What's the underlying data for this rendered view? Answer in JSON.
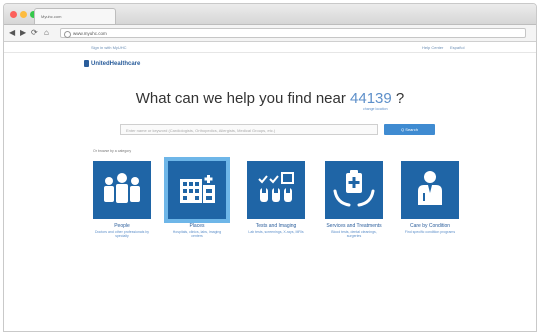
{
  "browser": {
    "tab_title": "Myuhc.com",
    "url": "www.myuhc.com",
    "back": "◀",
    "forward": "▶",
    "reload": "⟳",
    "home": "⌂"
  },
  "utility": {
    "left_link": "Sign in with MyUHC",
    "right_links": [
      "Help Center",
      "Español"
    ]
  },
  "logo": {
    "text": "UnitedHealthcare"
  },
  "hero": {
    "question": "What can we help you find near",
    "zip": "44139",
    "mark": "?",
    "change_location": "change location"
  },
  "search": {
    "placeholder": "Enter name or keyword (Cardiologists, Orthopedics, Allergists, Medical Groups, etc.)",
    "button": "Q Search"
  },
  "categories_prompt": "Or browse by a category",
  "categories": [
    {
      "label": "People",
      "desc": "Doctors and other professionals by specialty",
      "icon": "people-icon",
      "selected": false
    },
    {
      "label": "Places",
      "desc": "Hospitals, clinics, labs, imaging centers",
      "icon": "hospital-icon",
      "selected": true
    },
    {
      "label": "Tests and Imaging",
      "desc": "Lab tests, screenings, X-rays, MRIs",
      "icon": "tests-icon",
      "selected": false
    },
    {
      "label": "Services and Treatments",
      "desc": "Blood tests, dental cleanings, surgeries",
      "icon": "medical-services-icon",
      "selected": false
    },
    {
      "label": "Care by Condition",
      "desc": "Find specific condition programs",
      "icon": "doctor-icon",
      "selected": false
    }
  ],
  "colors": {
    "tile": "#1f65a6",
    "selected_border": "#6eb6e8",
    "accent": "#5d8fc9"
  }
}
